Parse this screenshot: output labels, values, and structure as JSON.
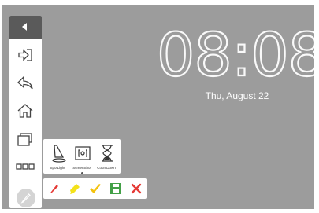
{
  "clock": {
    "hours": "08",
    "separator": ":",
    "minutes": "08"
  },
  "date": "Thu, August 22",
  "sidebar": {
    "items": [
      {
        "name": "collapse",
        "icon": "triangle-left-icon"
      },
      {
        "name": "exit",
        "icon": "exit-arrow-icon"
      },
      {
        "name": "back",
        "icon": "back-arrow-icon"
      },
      {
        "name": "home",
        "icon": "home-icon"
      },
      {
        "name": "recent-apps",
        "icon": "stacked-windows-icon"
      },
      {
        "name": "more",
        "icon": "three-squares-icon"
      },
      {
        "name": "annotate",
        "icon": "pen-icon"
      }
    ]
  },
  "tools": [
    {
      "label": "SpotLight",
      "icon": "spotlight-icon"
    },
    {
      "label": "ScreenShot",
      "icon": "screenshot-icon"
    },
    {
      "label": "CountDown",
      "icon": "hourglass-icon"
    }
  ],
  "pen_tools": [
    {
      "name": "red-pen",
      "icon": "pencil-icon",
      "color": "#e53935"
    },
    {
      "name": "highlighter",
      "icon": "highlighter-icon",
      "color": "#f4e21a"
    },
    {
      "name": "eraser",
      "icon": "eraser-icon",
      "color": "#f4c20d"
    },
    {
      "name": "save",
      "icon": "save-icon",
      "color": "#43a047"
    },
    {
      "name": "close",
      "icon": "close-icon",
      "color": "#e53935"
    }
  ],
  "colors": {
    "background": "#9c9c9c",
    "sidebar_header": "#5a5a5a"
  }
}
